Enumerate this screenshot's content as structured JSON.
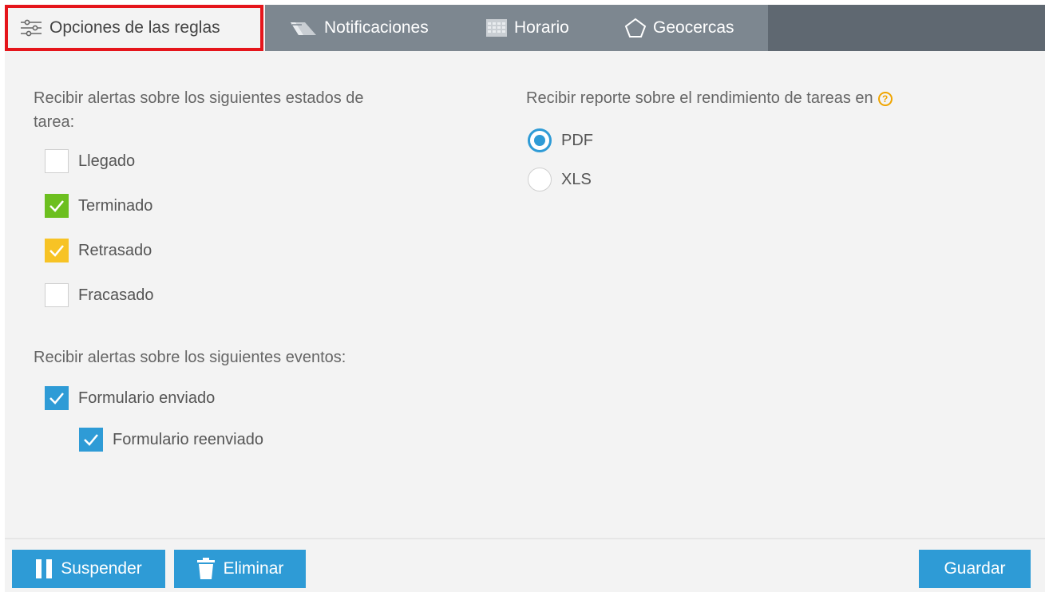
{
  "tabs": [
    {
      "label": "Opciones de las reglas",
      "icon": "sliders-icon",
      "active": true
    },
    {
      "label": "Notificaciones",
      "icon": "road-icon",
      "active": false
    },
    {
      "label": "Horario",
      "icon": "calendar-icon",
      "active": false
    },
    {
      "label": "Geocercas",
      "icon": "pentagon-icon",
      "active": false
    }
  ],
  "task_states": {
    "heading": "Recibir alertas sobre los siguientes estados de tarea:",
    "heading_line1": "Recibir alertas sobre los siguientes estados de",
    "heading_line2": "tarea:",
    "items": [
      {
        "label": "Llegado",
        "checked": false,
        "color": "#ffffff"
      },
      {
        "label": "Terminado",
        "checked": true,
        "color": "#6cbf1f"
      },
      {
        "label": "Retrasado",
        "checked": true,
        "color": "#f7c325"
      },
      {
        "label": "Fracasado",
        "checked": false,
        "color": "#ffffff"
      }
    ]
  },
  "events": {
    "heading": "Recibir alertas sobre los siguientes eventos:",
    "items": [
      {
        "label": "Formulario enviado",
        "checked": true,
        "color": "#2e9bd6"
      },
      {
        "label": "Formulario reenviado",
        "checked": true,
        "color": "#2e9bd6"
      }
    ]
  },
  "report": {
    "heading": "Recibir reporte sobre el rendimiento de tareas en",
    "help_symbol": "?",
    "options": [
      {
        "label": "PDF",
        "selected": true
      },
      {
        "label": "XLS",
        "selected": false
      }
    ]
  },
  "footer": {
    "suspend_label": "Suspender",
    "delete_label": "Eliminar",
    "save_label": "Guardar"
  },
  "colors": {
    "accent": "#2e9bd6",
    "tabbar": "#7d8790",
    "highlight": "#e5151b"
  }
}
